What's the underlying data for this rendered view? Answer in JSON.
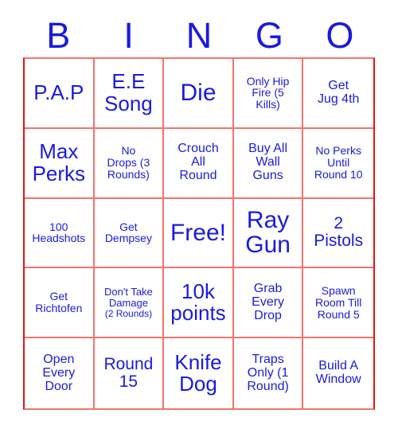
{
  "card": {
    "title": "BINGO",
    "headers": [
      "B",
      "I",
      "N",
      "G",
      "O"
    ],
    "colors": {
      "text_blue": "#1a1ae0",
      "grid_red": "#f4736d",
      "grid_red_dark": "#e81414",
      "background": "#ffffff"
    },
    "rows": [
      [
        {
          "text": "P.A.P",
          "size": "lg"
        },
        {
          "text": "E.E\nSong",
          "size": "lg"
        },
        {
          "text": "Die",
          "size": "xl"
        },
        {
          "text": "Only Hip\nFire (5\nKills)",
          "size": "xs"
        },
        {
          "text": "Get\nJug 4th",
          "size": "sm"
        }
      ],
      [
        {
          "text": "Max\nPerks",
          "size": "lg"
        },
        {
          "text": "No\nDrops (3\nRounds)",
          "size": "xs"
        },
        {
          "text": "Crouch\nAll\nRound",
          "size": "sm"
        },
        {
          "text": "Buy All\nWall\nGuns",
          "size": "sm"
        },
        {
          "text": "No Perks\nUntil\nRound 10",
          "size": "xs"
        }
      ],
      [
        {
          "text": "100\nHeadshots",
          "size": "xs"
        },
        {
          "text": "Get\nDempsey",
          "size": "xs"
        },
        {
          "text": "Free!",
          "size": "xl",
          "free": true
        },
        {
          "text": "Ray\nGun",
          "size": "xl"
        },
        {
          "text": "2\nPistols",
          "size": "md"
        }
      ],
      [
        {
          "text": "Get\nRichtofen",
          "size": "xs"
        },
        {
          "text": "Don't Take\nDamage",
          "size": "xxs",
          "sub": "(2 Rounds)"
        },
        {
          "text": "10k\npoints",
          "size": "lg"
        },
        {
          "text": "Grab\nEvery\nDrop",
          "size": "sm"
        },
        {
          "text": "Spawn\nRoom Till\nRound 5",
          "size": "xs"
        }
      ],
      [
        {
          "text": "Open\nEvery\nDoor",
          "size": "sm"
        },
        {
          "text": "Round\n15",
          "size": "md"
        },
        {
          "text": "Knife\nDog",
          "size": "lg"
        },
        {
          "text": "Traps\nOnly (1\nRound)",
          "size": "sm"
        },
        {
          "text": "Build A\nWindow",
          "size": "sm"
        }
      ]
    ]
  }
}
